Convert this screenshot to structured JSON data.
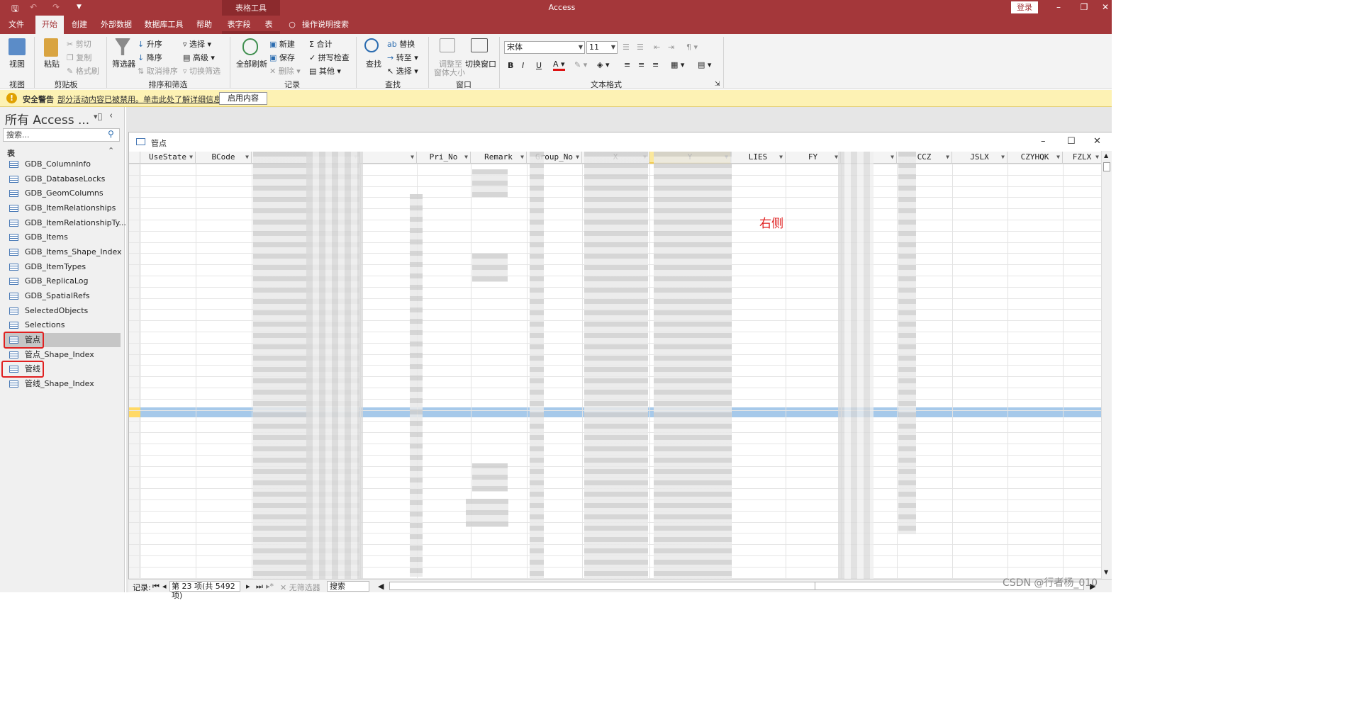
{
  "titlebar": {
    "context_tool": "表格工具",
    "app_title": "Access",
    "login": "登录"
  },
  "tabs": [
    "文件",
    "开始",
    "创建",
    "外部数据",
    "数据库工具",
    "帮助",
    "表字段",
    "表"
  ],
  "tell_me": "操作说明搜索",
  "ribbon": {
    "view": "视图",
    "paste": "粘贴",
    "cut": "剪切",
    "copy": "复制",
    "format_painter": "格式刷",
    "filter": "筛选器",
    "ascending": "升序",
    "descending": "降序",
    "remove_sort": "取消排序",
    "selection": "选择",
    "advanced": "高级",
    "toggle_filter": "切换筛选",
    "refresh_all": "全部刷新",
    "new": "新建",
    "save": "保存",
    "delete": "删除",
    "totals": "合计",
    "spelling": "拼写检查",
    "more": "其他",
    "find": "查找",
    "replace": "替换",
    "goto": "转至",
    "select": "选择",
    "size_to_fit_1": "调整至",
    "size_to_fit_2": "窗体大小",
    "switch_windows": "切换窗口",
    "font_name": "宋体",
    "font_size": "11",
    "groups": {
      "views": "视图",
      "clipboard": "剪贴板",
      "sort_filter": "排序和筛选",
      "records": "记录",
      "find": "查找",
      "window": "窗口",
      "text_format": "文本格式"
    }
  },
  "security": {
    "title": "安全警告",
    "message": "部分活动内容已被禁用。单击此处了解详细信息。",
    "enable_button": "启用内容"
  },
  "nav": {
    "title": "所有 Access ...",
    "search_placeholder": "搜索...",
    "section": "表",
    "items": [
      "GDB_ColumnInfo",
      "GDB_DatabaseLocks",
      "GDB_GeomColumns",
      "GDB_ItemRelationships",
      "GDB_ItemRelationshipTy...",
      "GDB_Items",
      "GDB_Items_Shape_Index",
      "GDB_ItemTypes",
      "GDB_ReplicaLog",
      "GDB_SpatialRefs",
      "SelectedObjects",
      "Selections",
      "管点",
      "管点_Shape_Index",
      "管线",
      "管线_Shape_Index"
    ]
  },
  "doc": {
    "title": "管点",
    "columns": [
      "UseState",
      "BCode",
      "",
      "",
      "Pri_No",
      "Remark",
      "Group_No",
      "X",
      "Y",
      "LIES",
      "FY",
      "",
      "CCZ",
      "JSLX",
      "CZYHQK",
      "FZLX"
    ],
    "annotation": "右侧"
  },
  "record_nav": {
    "label": "记录:",
    "position": "第 23 项(共 5492 项)",
    "filter": "无筛选器",
    "search": "搜索"
  },
  "watermark": "CSDN @行者杨_010"
}
